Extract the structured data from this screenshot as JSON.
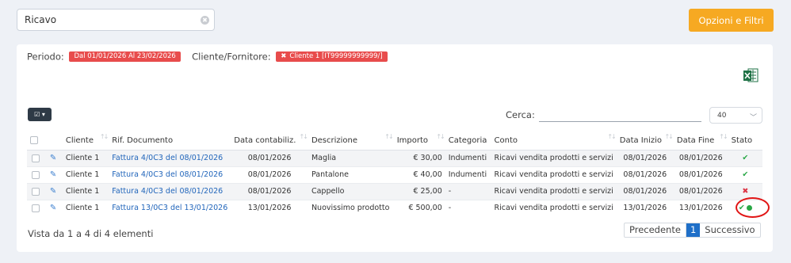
{
  "search": {
    "value": "Ricavo"
  },
  "buttons": {
    "filters": "Opzioni e Filtri"
  },
  "filters": {
    "period_label": "Periodo:",
    "period_chip": "Dal 01/01/2026 Al 23/02/2026",
    "client_label": "Cliente/Fornitore:",
    "client_chip": "Cliente 1 [IT99999999999/]"
  },
  "table_controls": {
    "search_label": "Cerca:",
    "page_size": "40"
  },
  "columns": [
    "Cliente",
    "Rif. Documento",
    "Data contabiliz.",
    "Descrizione",
    "Importo",
    "Categoria",
    "Conto",
    "Data Inizio",
    "Data Fine",
    "Stato"
  ],
  "rows": [
    {
      "cliente": "Cliente 1",
      "rif": "Fattura 4/0C3 del 08/01/2026",
      "data_contab": "08/01/2026",
      "descrizione": "Maglia",
      "importo": "€ 30,00",
      "categoria": "Indumenti",
      "conto": "Ricavi vendita prodotti e servizi",
      "data_inizio": "08/01/2026",
      "data_fine": "08/01/2026",
      "stato": "✔"
    },
    {
      "cliente": "Cliente 1",
      "rif": "Fattura 4/0C3 del 08/01/2026",
      "data_contab": "08/01/2026",
      "descrizione": "Pantalone",
      "importo": "€ 40,00",
      "categoria": "Indumenti",
      "conto": "Ricavi vendita prodotti e servizi",
      "data_inizio": "08/01/2026",
      "data_fine": "08/01/2026",
      "stato": "✔"
    },
    {
      "cliente": "Cliente 1",
      "rif": "Fattura 4/0C3 del 08/01/2026",
      "data_contab": "08/01/2026",
      "descrizione": "Cappello",
      "importo": "€ 25,00",
      "categoria": "-",
      "conto": "Ricavi vendita prodotti e servizi",
      "data_inizio": "08/01/2026",
      "data_fine": "08/01/2026",
      "stato": "✖"
    },
    {
      "cliente": "Cliente 1",
      "rif": "Fattura 13/0C3 del 13/01/2026",
      "data_contab": "13/01/2026",
      "descrizione": "Nuovissimo prodotto",
      "importo": "€ 500,00",
      "categoria": "-",
      "conto": "Ricavi vendita prodotti e servizi",
      "data_inizio": "13/01/2026",
      "data_fine": "13/01/2026",
      "stato": "✔"
    }
  ],
  "footer": {
    "info": "Vista da 1 a 4 di 4 elementi",
    "prev": "Precedente",
    "page": "1",
    "next": "Successivo"
  },
  "icons": {
    "excel": "excel-export-icon",
    "edit": "edit-icon",
    "columns": "column-select-icon"
  },
  "colors": {
    "accent": "#f6a922",
    "chip": "#e84c4c",
    "ok": "#28a745",
    "ko": "#dc3545",
    "link": "#2266bb"
  }
}
